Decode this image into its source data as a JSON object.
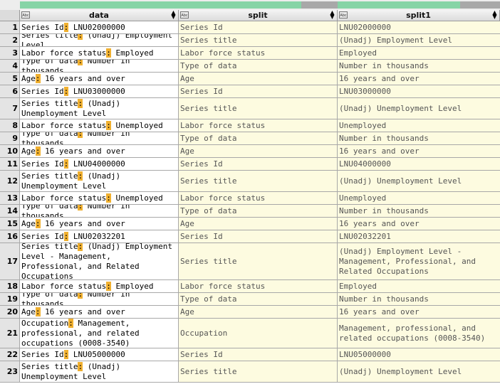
{
  "table": {
    "columns": [
      "data",
      "split",
      "split1"
    ],
    "type_badge": "Abc",
    "rows": [
      {
        "num": "1",
        "data": {
          "a": "Series Id",
          "b": " LNU02000000"
        },
        "split": "Series Id",
        "split1": "LNU02000000"
      },
      {
        "num": "2",
        "data": {
          "a": "Series title",
          "b": " (Unadj) Employment Level"
        },
        "split": "Series title",
        "split1": "(Unadj) Employment Level"
      },
      {
        "num": "3",
        "data": {
          "a": "Labor force status",
          "b": " Employed"
        },
        "split": "Labor force status",
        "split1": "Employed"
      },
      {
        "num": "4",
        "data": {
          "a": "Type of data",
          "b": " Number in thousands"
        },
        "split": "Type of data",
        "split1": "Number in thousands"
      },
      {
        "num": "5",
        "data": {
          "a": "Age",
          "b": " 16 years and over"
        },
        "split": "Age",
        "split1": "16 years and over"
      },
      {
        "num": "6",
        "data": {
          "a": "Series Id",
          "b": " LNU03000000"
        },
        "split": "Series Id",
        "split1": "LNU03000000"
      },
      {
        "num": "7",
        "data": {
          "a": "Series title",
          "b": " (Unadj) Unemployment Level"
        },
        "split": "Series title",
        "split1": "(Unadj) Unemployment Level"
      },
      {
        "num": "8",
        "data": {
          "a": "Labor force status",
          "b": " Unemployed"
        },
        "split": "Labor force status",
        "split1": "Unemployed"
      },
      {
        "num": "9",
        "data": {
          "a": "Type of data",
          "b": " Number in thousands"
        },
        "split": "Type of data",
        "split1": "Number in thousands"
      },
      {
        "num": "10",
        "data": {
          "a": "Age",
          "b": " 16 years and over"
        },
        "split": "Age",
        "split1": "16 years and over"
      },
      {
        "num": "11",
        "data": {
          "a": "Series Id",
          "b": " LNU04000000"
        },
        "split": "Series Id",
        "split1": "LNU04000000"
      },
      {
        "num": "12",
        "data": {
          "a": "Series title",
          "b": " (Unadj) Unemployment Level"
        },
        "split": "Series title",
        "split1": "(Unadj) Unemployment Level"
      },
      {
        "num": "13",
        "data": {
          "a": "Labor force status",
          "b": " Unemployed"
        },
        "split": "Labor force status",
        "split1": "Unemployed"
      },
      {
        "num": "14",
        "data": {
          "a": "Type of data",
          "b": " Number in thousands"
        },
        "split": "Type of data",
        "split1": "Number in thousands"
      },
      {
        "num": "15",
        "data": {
          "a": "Age",
          "b": " 16 years and over"
        },
        "split": "Age",
        "split1": "16 years and over"
      },
      {
        "num": "16",
        "data": {
          "a": "Series Id",
          "b": " LNU02032201"
        },
        "split": "Series Id",
        "split1": "LNU02032201"
      },
      {
        "num": "17",
        "data": {
          "a": "Series title",
          "b": " (Unadj) Employment Level - Management, Professional, and Related Occupations"
        },
        "split": "Series title",
        "split1": "(Unadj) Employment Level - Management, Professional, and Related Occupations"
      },
      {
        "num": "18",
        "data": {
          "a": "Labor force status",
          "b": " Employed"
        },
        "split": "Labor force status",
        "split1": "Employed"
      },
      {
        "num": "19",
        "data": {
          "a": "Type of data",
          "b": " Number in thousands"
        },
        "split": "Type of data",
        "split1": "Number in thousands"
      },
      {
        "num": "20",
        "data": {
          "a": "Age",
          "b": " 16 years and over"
        },
        "split": "Age",
        "split1": "16 years and over"
      },
      {
        "num": "21",
        "data": {
          "a": "Occupation",
          "b": " Management, professional, and related occupations (0008-3540)"
        },
        "split": "Occupation",
        "split1": "Management, professional, and related occupations (0008-3540)"
      },
      {
        "num": "22",
        "data": {
          "a": "Series Id",
          "b": " LNU05000000"
        },
        "split": "Series Id",
        "split1": "LNU05000000"
      },
      {
        "num": "23",
        "data": {
          "a": "Series title",
          "b": " (Unadj) Unemployment Level"
        },
        "split": "Series title",
        "split1": "(Unadj) Unemployment Level"
      }
    ]
  },
  "colors": {
    "header_progress": "#86d4a6",
    "header_progress_rest": "#a8a8a8",
    "delimiter_highlight": "#f0b030",
    "split_cell_bg": "#fdfbe0"
  }
}
